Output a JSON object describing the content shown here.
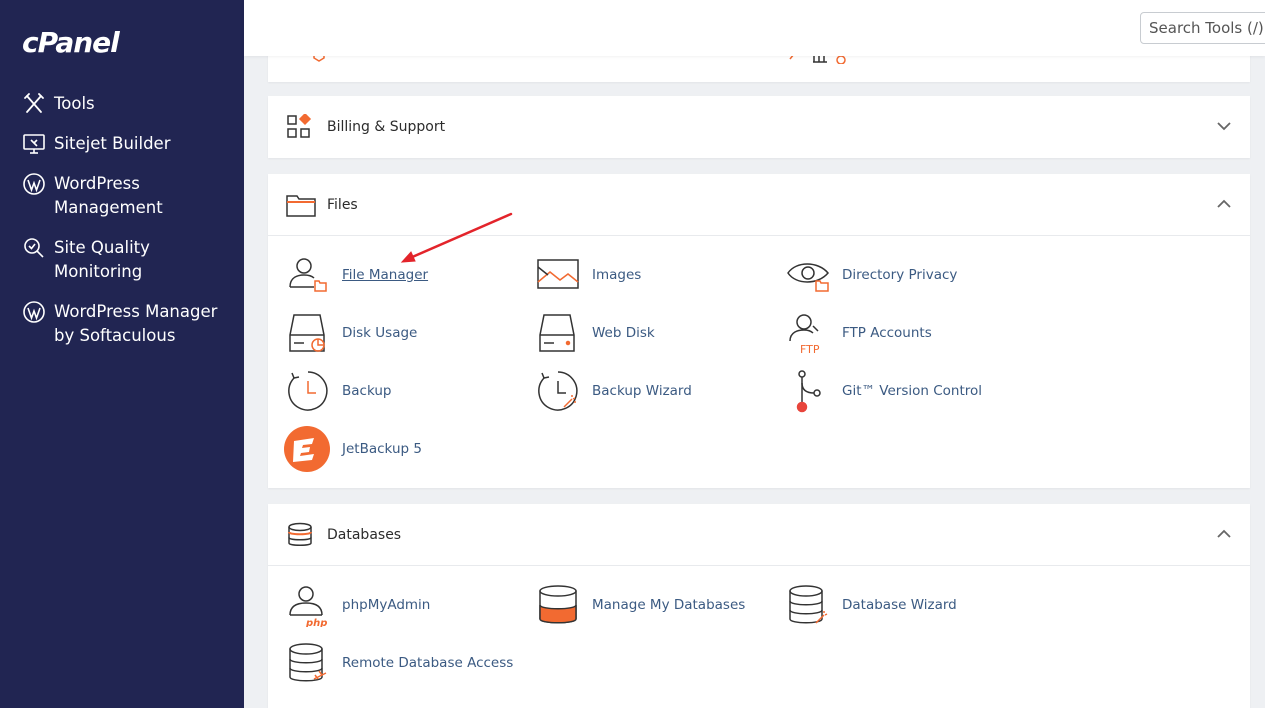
{
  "sidebar": {
    "logo": "cPanel",
    "items": [
      {
        "label": "Tools",
        "icon": "tools-icon"
      },
      {
        "label": "Sitejet Builder",
        "icon": "sitejet-icon"
      },
      {
        "label": "WordPress\nManagement",
        "icon": "wordpress-icon"
      },
      {
        "label": "Site Quality\nMonitoring",
        "icon": "site-quality-icon"
      },
      {
        "label": "WordPress Manager\nby Softaculous",
        "icon": "wordpress-icon"
      }
    ]
  },
  "header": {
    "search_placeholder": "Search Tools (/)"
  },
  "sections": {
    "billing": {
      "title": "Billing & Support",
      "icon": "billing-icon",
      "state": "collapsed"
    },
    "files": {
      "title": "Files",
      "icon": "folder-icon",
      "state": "expanded",
      "tools": [
        {
          "label": "File Manager",
          "icon": "file-manager-icon"
        },
        {
          "label": "Images",
          "icon": "images-icon"
        },
        {
          "label": "Directory Privacy",
          "icon": "directory-privacy-icon"
        },
        {
          "label": "Disk Usage",
          "icon": "disk-usage-icon"
        },
        {
          "label": "Web Disk",
          "icon": "web-disk-icon"
        },
        {
          "label": "FTP Accounts",
          "icon": "ftp-accounts-icon"
        },
        {
          "label": "Backup",
          "icon": "backup-icon"
        },
        {
          "label": "Backup Wizard",
          "icon": "backup-wizard-icon"
        },
        {
          "label": "Git™ Version Control",
          "icon": "git-icon"
        },
        {
          "label": "JetBackup 5",
          "icon": "jetbackup-icon"
        }
      ]
    },
    "databases": {
      "title": "Databases",
      "icon": "database-icon",
      "state": "expanded",
      "tools": [
        {
          "label": "phpMyAdmin",
          "icon": "phpmyadmin-icon"
        },
        {
          "label": "Manage My Databases",
          "icon": "manage-databases-icon"
        },
        {
          "label": "Database Wizard",
          "icon": "database-wizard-icon"
        },
        {
          "label": "Remote Database Access",
          "icon": "remote-database-icon"
        }
      ]
    }
  },
  "colors": {
    "sidebar_bg": "#212552",
    "accent_orange": "#f26a31",
    "link_blue": "#3b5a82",
    "annotation_arrow": "#e3242b"
  }
}
